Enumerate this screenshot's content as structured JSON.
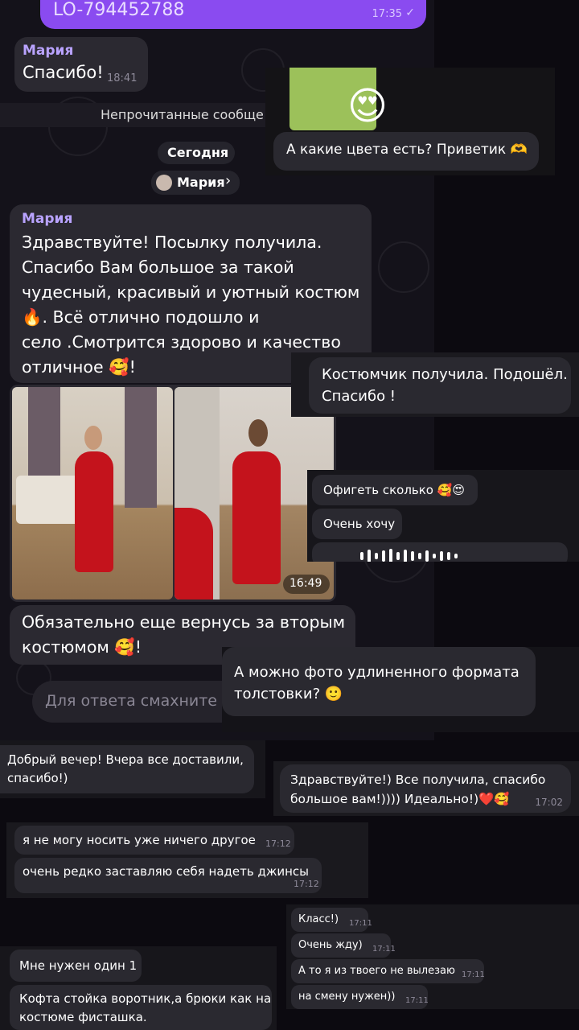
{
  "top_bubble": {
    "text": "LO-794452788",
    "time": "17:35",
    "check": "✓"
  },
  "msg_thanks": {
    "name": "Мария",
    "text": "Спасибо!",
    "time": "18:41"
  },
  "unread_label": "Непрочитанные сообще",
  "date_label": "Сегодня",
  "profile_chip": {
    "name": "Мария",
    "chevron": "›"
  },
  "colors_question": {
    "text": "А какие цвета есть? Приветик 🫶",
    "emoji": "😍"
  },
  "review_msg": {
    "name": "Мария",
    "lines": [
      "Здравствуйте! Посылку получила.",
      "Спасибо Вам большое за такой",
      "чудесный, красивый и уютный костюм",
      "🔥. Всё отлично подошло и",
      "село .Смотрится здорово и качество",
      "отличное 🥰!"
    ]
  },
  "photo_time": "16:49",
  "return_msg": {
    "lines": [
      "Обязательно еще вернусь за вторым",
      "костюмом 🥰!"
    ]
  },
  "reply_input": {
    "placeholder": "Для ответа смахните сс"
  },
  "suit_received": {
    "lines": [
      "Костюмчик получила. Подошёл.",
      "Спасибо !"
    ]
  },
  "wow_msg": {
    "text": "Офигеть сколько 🥰😍"
  },
  "want_msg": {
    "text": "Очень хочу"
  },
  "photo_question": {
    "lines": [
      "А можно фото удлиненного формата",
      "толстовки? 🙂"
    ]
  },
  "evening_msg": {
    "lines": [
      "Добрый вечер! Вчера все доставили,",
      "спасибо!)"
    ]
  },
  "received_all": {
    "lines": [
      "Здравствуйте!) Все получила, спасибо",
      "большое вам!)))) Идеально!)❤️🥰"
    ],
    "time": "17:02"
  },
  "cant_wear": {
    "text": "я не могу носить уже ничего другое",
    "time": "17:12"
  },
  "jeans_msg": {
    "text": "очень редко заставляю себя надеть джинсы",
    "time": "17:12"
  },
  "class_msgs": [
    {
      "text": "Класс!)",
      "time": "17:11"
    },
    {
      "text": "Очень жду)",
      "time": "17:11"
    },
    {
      "text": "А то я из твоего не вылезаю",
      "time": "17:11"
    },
    {
      "text": "на смену нужен))",
      "time": "17:11"
    }
  ],
  "need_one": {
    "text": "Мне нужен один 1"
  },
  "order_details": {
    "lines": [
      "Кофта стойка воротник,а брюки как на",
      "костюме фисташка."
    ]
  },
  "colors": {
    "accent": "#b9a3ff",
    "top_bubble": "#8a4bf0",
    "heart": "#e0254d"
  }
}
